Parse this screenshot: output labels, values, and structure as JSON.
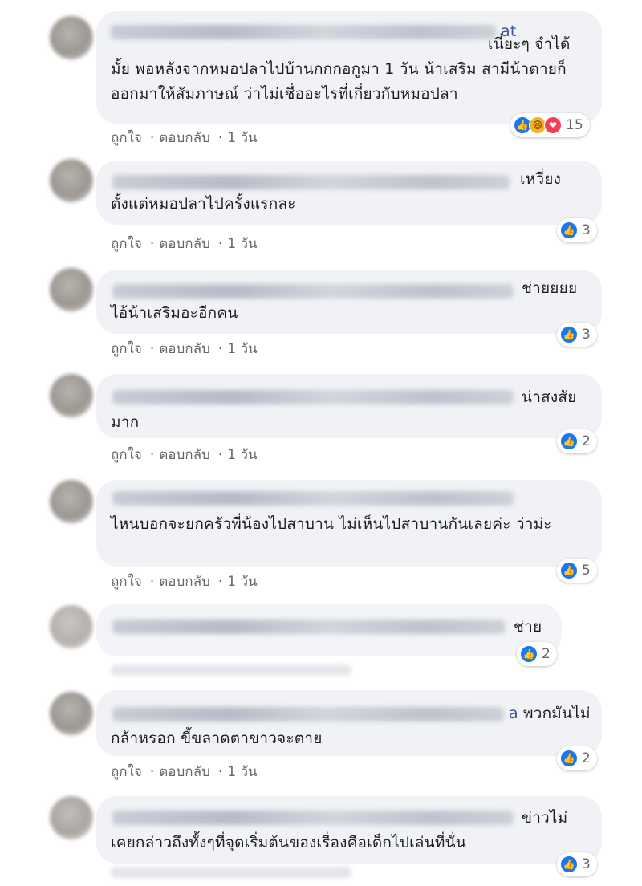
{
  "ui": {
    "like_label": "ถูกใจ",
    "reply_label": "ตอบกลับ",
    "separator": "·",
    "like_color": "#1877f2",
    "bubble_color": "#f0f2f5"
  },
  "comments": [
    {
      "name_visible": "at",
      "text": "เนี่ยะๆ จำได้มั้ย พอหลังจากหมอปลาไปบ้านกกกอกูมา 1 วัน น้าเสริม สามีน้าตายก็ออกมาให้สัมภาษณ์ ว่าไม่เชื่ออะไรที่เกี่ยวกับหมอปลา",
      "time": "1 วัน",
      "reactions": [
        "like-icon",
        "haha-icon",
        "love-icon"
      ],
      "reaction_count": "15"
    },
    {
      "text": "เหวี่ยงตั้งแต่หมอปลาไปครั้งแรกละ",
      "time": "1 วัน",
      "reactions": [
        "like-icon"
      ],
      "reaction_count": "3"
    },
    {
      "text": "ช่ายยยย ไอ้น้าเสริมอะอีกคน",
      "time": "1 วัน",
      "reactions": [
        "like-icon"
      ],
      "reaction_count": "3"
    },
    {
      "text": "น่าสงสัยมาก",
      "time": "1 วัน",
      "reactions": [
        "like-icon"
      ],
      "reaction_count": "2"
    },
    {
      "text": "ไหนบอกจะยกครัวพี่น้องไปสาบาน ไม่เห็นไปสาบานกันเลยค่ะ ว่าม่ะ",
      "time": "1 วัน",
      "reactions": [
        "like-icon"
      ],
      "reaction_count": "5"
    },
    {
      "text": "ช่าย",
      "reactions": [
        "like-icon"
      ],
      "reaction_count": "2"
    },
    {
      "name_visible": "a",
      "text": "พวกมันไม่กล้าหรอก ขี้ขลาดตาขาวจะตาย",
      "time": "1 วัน",
      "reactions": [
        "like-icon"
      ],
      "reaction_count": "2"
    },
    {
      "text": "ข่าวไม่เคยกล่าวถึงทั้งๆที่จุดเริ่มต้นของเรื่องคือเด็กไปเล่นที่นั่น",
      "reactions": [
        "like-icon"
      ],
      "reaction_count": "3"
    }
  ]
}
